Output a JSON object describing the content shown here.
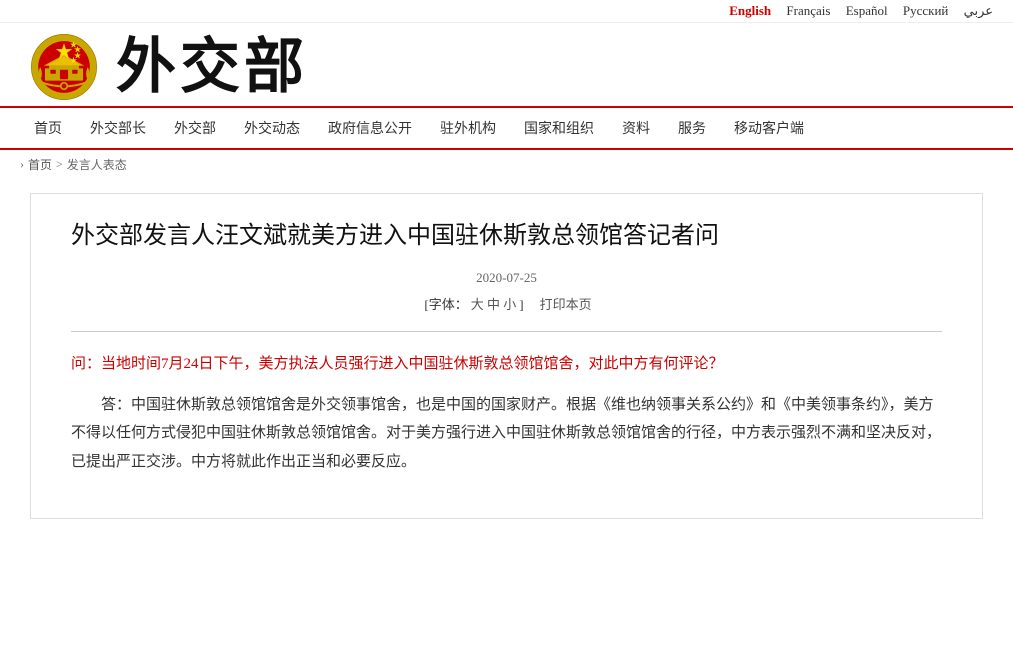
{
  "lang_bar": {
    "languages": [
      {
        "label": "English",
        "active": true
      },
      {
        "label": "Français",
        "active": false
      },
      {
        "label": "Español",
        "active": false
      },
      {
        "label": "Русский",
        "active": false
      },
      {
        "label": "عربي",
        "active": false
      }
    ]
  },
  "header": {
    "logo_text": "外交部"
  },
  "nav": {
    "items": [
      {
        "label": "首页"
      },
      {
        "label": "外交部长"
      },
      {
        "label": "外交部"
      },
      {
        "label": "外交动态"
      },
      {
        "label": "政府信息公开"
      },
      {
        "label": "驻外机构"
      },
      {
        "label": "国家和组织"
      },
      {
        "label": "资料"
      },
      {
        "label": "服务"
      },
      {
        "label": "移动客户端"
      }
    ]
  },
  "breadcrumb": {
    "home": "首页",
    "separator": "›",
    "current": "发言人表态"
  },
  "article": {
    "title": "外交部发言人汪文斌就美方进入中国驻休斯敦总领馆答记者问",
    "date": "2020-07-25",
    "font_label": "[字体：",
    "font_large": "大",
    "font_medium": "中",
    "font_small": "小",
    "font_end": "]",
    "print_label": "打印本页",
    "question": "问：当地时间7月24日下午，美方执法人员强行进入中国驻休斯敦总领馆馆舍，对此中方有何评论？",
    "answer": "答：中国驻休斯敦总领馆馆舍是外交领事馆舍，也是中国的国家财产。根据《维也纳领事关系公约》和《中美领事条约》，美方不得以任何方式侵犯中国驻休斯敦总领馆馆舍。对于美方强行进入中国驻休斯敦总领馆馆舍的行径，中方表示强烈不满和坚决反对，已提出严正交涉。中方将就此作出正当和必要反应。"
  }
}
